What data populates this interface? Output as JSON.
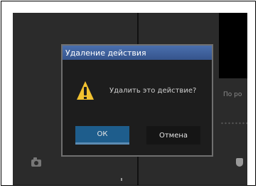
{
  "dialog": {
    "title": "Удаление действия",
    "message": "Удалить это действие?",
    "ok_label": "ОК",
    "cancel_label": "Отмена"
  },
  "background": {
    "side_label": "По ро"
  },
  "icons": {
    "warning": "warning-icon",
    "camera": "camera-icon",
    "shield": "shield-icon"
  },
  "colors": {
    "titlebar": "#35548c",
    "ok_button": "#1e5d8c",
    "warning": "#f2c230"
  }
}
